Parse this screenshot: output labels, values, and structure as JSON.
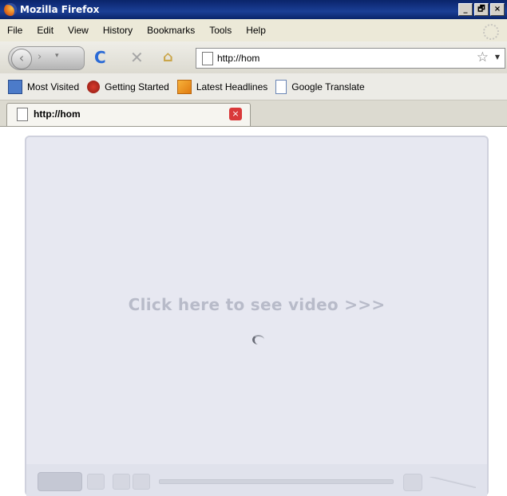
{
  "window": {
    "title": "Mozilla Firefox",
    "controls": [
      "_",
      "🗗",
      "×"
    ]
  },
  "menu": {
    "items": [
      "File",
      "Edit",
      "View",
      "History",
      "Bookmarks",
      "Tools",
      "Help"
    ]
  },
  "nav": {
    "back_glyph": "‹",
    "forward_glyph": "›",
    "history_glyph": "▾",
    "reload_glyph": "C",
    "stop_glyph": "✕",
    "home_glyph": "⌂",
    "url": "http://hom",
    "star_glyph": "☆",
    "dropdown_glyph": "▼"
  },
  "bookmarks": {
    "items": [
      "Most Visited",
      "Getting Started",
      "Latest Headlines",
      "Google Translate"
    ]
  },
  "tab": {
    "label": "http://hom",
    "close_glyph": "×"
  },
  "content": {
    "cta_text": "Click here to see video >>>"
  },
  "colors": {
    "titlebar": "#0a246a",
    "cta": "#b8bbc9",
    "player_bg": "#e7e8f1"
  },
  "icons": [
    "firefox-logo",
    "back-icon",
    "forward-icon",
    "reload-icon",
    "stop-icon",
    "home-icon",
    "page-icon",
    "star-icon",
    "rss-icon",
    "close-icon"
  ]
}
